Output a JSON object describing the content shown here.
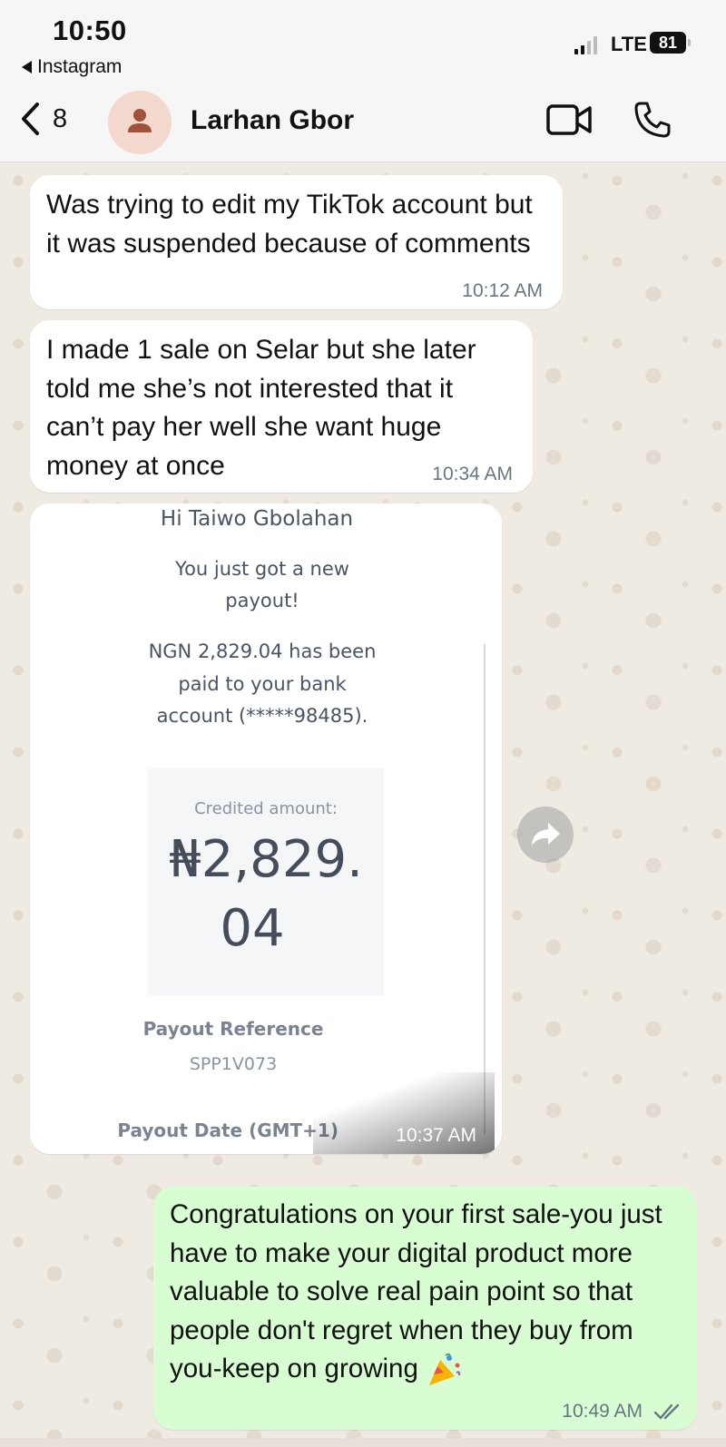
{
  "status_bar": {
    "time": "10:50",
    "back_app": "Instagram",
    "network": "LTE",
    "battery": "81"
  },
  "header": {
    "back_count": "8",
    "contact_name": "Larhan Gbor",
    "icons": [
      "chevron-left-icon",
      "person-icon",
      "video-call-icon",
      "phone-icon"
    ]
  },
  "messages": [
    {
      "direction": "incoming",
      "text": "Was trying to edit my TikTok account but it was suspended because of comments",
      "time": "10:12 AM"
    },
    {
      "direction": "incoming",
      "text": "I made 1 sale on Selar but she later told me she’s not interested that it can’t pay her well she want huge money at once",
      "time": "10:34 AM"
    },
    {
      "direction": "incoming",
      "type": "image",
      "time": "10:37 AM",
      "receipt": {
        "greeting": "Hi Taiwo Gbolahan",
        "line1": "You just got a new",
        "line2": "payout!",
        "line3": "NGN 2,829.04 has been",
        "line4": "paid to your bank",
        "line5": "account (*****98485).",
        "credited_label": "Credited amount:",
        "amount_part1": "₦2,829.",
        "amount_part2": "04",
        "reference_label": "Payout Reference",
        "reference_value": "SPP1V073",
        "date_label": "Payout Date (GMT+1)"
      }
    },
    {
      "direction": "outgoing",
      "text": "Congratulations on your first sale-you just have to make your digital product more valuable to solve real pain point so that people don't regret when they buy from you-keep on growing",
      "emoji": "party-popper",
      "time": "10:49 AM",
      "status": "read"
    }
  ],
  "colors": {
    "incoming_bubble": "#ffffff",
    "outgoing_bubble": "#d9fdd3",
    "chat_background": "#efeae2",
    "timestamp": "#667781"
  }
}
